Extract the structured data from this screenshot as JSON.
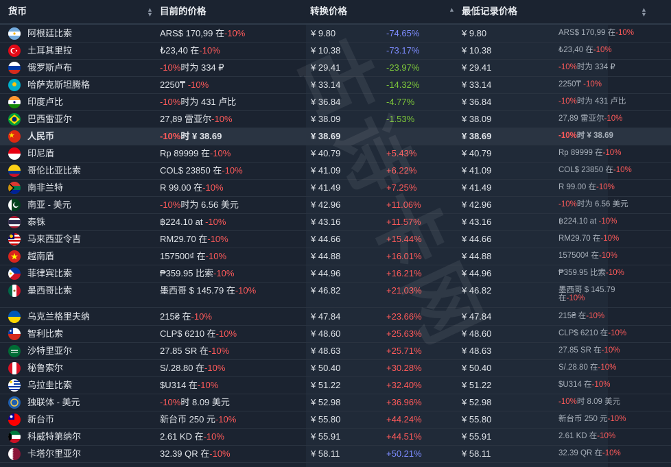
{
  "header": {
    "currency": "货币",
    "current": "目前的价格",
    "converted": "转换价格",
    "lowest": "最低记录价格"
  },
  "watermark": "古诗卡网",
  "colors": {
    "negative_red": "#ff5a5a",
    "pct_blue": "#7d8cff",
    "pct_green": "#7ec83a",
    "pct_red": "#ff5a5a"
  },
  "rows": [
    {
      "name": "阿根廷比索",
      "flag": "flag-ar",
      "cur": "ARS$ 170,99 在",
      "off": "-10%",
      "conv": "¥ 9.80",
      "pct": "-74.65%",
      "pcolor": "blue",
      "low": "¥ 9.80",
      "low_cur": "ARS$ 170,99 在",
      "low_off": "-10%"
    },
    {
      "name": "土耳其里拉",
      "flag": "flag-tr",
      "cur": "₺23,40 在",
      "off": "-10%",
      "conv": "¥ 10.38",
      "pct": "-73.17%",
      "pcolor": "blue",
      "low": "¥ 10.38",
      "low_cur": "₺23,40 在",
      "low_off": "-10%"
    },
    {
      "name": "俄罗斯卢布",
      "flag": "flag-ru",
      "pre": "-10%",
      "cur": "时为 334 ₽",
      "off": "",
      "conv": "¥ 29.41",
      "pct": "-23.97%",
      "pcolor": "green",
      "low": "¥ 29.41",
      "low_pre": "-10%",
      "low_cur": "时为 334 ₽",
      "low_off": ""
    },
    {
      "name": "哈萨克斯坦腾格",
      "flag": "flag-kz",
      "cur": "2250₸ ",
      "off": "-10%",
      "conv": "¥ 33.14",
      "pct": "-14.32%",
      "pcolor": "green",
      "low": "¥ 33.14",
      "low_cur": "2250₸ ",
      "low_off": "-10%"
    },
    {
      "name": "印度卢比",
      "flag": "flag-in",
      "pre": "-10%",
      "cur": "时为 431 卢比",
      "off": "",
      "conv": "¥ 36.84",
      "pct": "-4.77%",
      "pcolor": "green",
      "low": "¥ 36.84",
      "low_pre": "-10%",
      "low_cur": "时为 431 卢比",
      "low_off": ""
    },
    {
      "name": "巴西雷亚尔",
      "flag": "flag-br",
      "cur": "27,89 雷亚尔",
      "off": "-10%",
      "conv": "¥ 38.09",
      "pct": "-1.53%",
      "pcolor": "green",
      "low": "¥ 38.09",
      "low_cur": "27,89 雷亚尔",
      "low_off": "-10%"
    },
    {
      "name": "人民币",
      "flag": "flag-cn",
      "pre": "-10%",
      "cur": "时 ¥ 38.69",
      "off": "",
      "conv": "¥ 38.69",
      "pct": "",
      "pcolor": "",
      "low": "¥ 38.69",
      "low_pre": "-10%",
      "low_cur": "时 ¥ 38.69",
      "low_off": "",
      "highlight": true
    },
    {
      "name": "印尼盾",
      "flag": "flag-id",
      "cur": "Rp 89999 在",
      "off": "-10%",
      "conv": "¥ 40.79",
      "pct": "+5.43%",
      "pcolor": "red",
      "low": "¥ 40.79",
      "low_cur": "Rp 89999 在",
      "low_off": "-10%"
    },
    {
      "name": "哥伦比亚比索",
      "flag": "flag-co",
      "cur": "COL$ 23850 在",
      "off": "-10%",
      "conv": "¥ 41.09",
      "pct": "+6.22%",
      "pcolor": "red",
      "low": "¥ 41.09",
      "low_cur": "COL$ 23850 在",
      "low_off": "-10%"
    },
    {
      "name": "南非兰特",
      "flag": "flag-za",
      "cur": "R 99.00 在",
      "off": "-10%",
      "conv": "¥ 41.49",
      "pct": "+7.25%",
      "pcolor": "red",
      "low": "¥ 41.49",
      "low_cur": "R 99.00 在",
      "low_off": "-10%"
    },
    {
      "name": "南亚 - 美元",
      "flag": "flag-pk",
      "pre": "-10%",
      "cur": "时为 6.56 美元",
      "off": "",
      "conv": "¥ 42.96",
      "pct": "+11.06%",
      "pcolor": "red",
      "low": "¥ 42.96",
      "low_pre": "-10%",
      "low_cur": "时为 6.56 美元",
      "low_off": ""
    },
    {
      "name": "泰铢",
      "flag": "flag-th",
      "cur": "฿224.10 at ",
      "off": "-10%",
      "conv": "¥ 43.16",
      "pct": "+11.57%",
      "pcolor": "red",
      "low": "¥ 43.16",
      "low_cur": "฿224.10 at ",
      "low_off": "-10%"
    },
    {
      "name": "马来西亚令吉",
      "flag": "flag-my",
      "cur": "RM29.70 在",
      "off": "-10%",
      "conv": "¥ 44.66",
      "pct": "+15.44%",
      "pcolor": "red",
      "low": "¥ 44.66",
      "low_cur": "RM29.70 在",
      "low_off": "-10%"
    },
    {
      "name": "越南盾",
      "flag": "flag-vn",
      "cur": "157500₫ 在",
      "off": "-10%",
      "conv": "¥ 44.88",
      "pct": "+16.01%",
      "pcolor": "red",
      "low": "¥ 44.88",
      "low_cur": "157500₫ 在",
      "low_off": "-10%"
    },
    {
      "name": "菲律宾比索",
      "flag": "flag-ph",
      "cur": "₱359.95 比索",
      "off": "-10%",
      "conv": "¥ 44.96",
      "pct": "+16.21%",
      "pcolor": "red",
      "low": "¥ 44.96",
      "low_cur": "₱359.95 比索",
      "low_off": "-10%"
    },
    {
      "name": "墨西哥比索",
      "flag": "flag-mx",
      "cur": "墨西哥 $ 145.79 在",
      "off": "-10%",
      "conv": "¥ 46.82",
      "pct": "+21.03%",
      "pcolor": "red",
      "low": "¥ 46.82",
      "low_cur": "墨西哥 $ 145.79",
      "low_cur2": "在",
      "low_off": "-10%",
      "tall": true
    },
    {
      "name": "乌克兰格里夫纳",
      "flag": "flag-ua",
      "cur": "215₴ 在",
      "off": "-10%",
      "conv": "¥ 47.84",
      "pct": "+23.66%",
      "pcolor": "red",
      "low": "¥ 47.84",
      "low_cur": "215₴ 在",
      "low_off": "-10%"
    },
    {
      "name": "智利比索",
      "flag": "flag-cl",
      "cur": "CLP$ 6210 在",
      "off": "-10%",
      "conv": "¥ 48.60",
      "pct": "+25.63%",
      "pcolor": "red",
      "low": "¥ 48.60",
      "low_cur": "CLP$ 6210 在",
      "low_off": "-10%"
    },
    {
      "name": "沙特里亚尔",
      "flag": "flag-sa",
      "cur": "27.85 SR 在",
      "off": "-10%",
      "conv": "¥ 48.63",
      "pct": "+25.71%",
      "pcolor": "red",
      "low": "¥ 48.63",
      "low_cur": "27.85 SR 在",
      "low_off": "-10%"
    },
    {
      "name": "秘鲁索尔",
      "flag": "flag-pe",
      "cur": "S/.28.80 在",
      "off": "-10%",
      "conv": "¥ 50.40",
      "pct": "+30.28%",
      "pcolor": "red",
      "low": "¥ 50.40",
      "low_cur": "S/.28.80 在",
      "low_off": "-10%"
    },
    {
      "name": "乌拉圭比索",
      "flag": "flag-uy",
      "cur": "$U314 在",
      "off": "-10%",
      "conv": "¥ 51.22",
      "pct": "+32.40%",
      "pcolor": "red",
      "low": "¥ 51.22",
      "low_cur": "$U314 在",
      "low_off": "-10%"
    },
    {
      "name": "独联体 - 美元",
      "flag": "flag-cis",
      "pre": "-10%",
      "cur": "时 8.09 美元",
      "off": "",
      "conv": "¥ 52.98",
      "pct": "+36.96%",
      "pcolor": "red",
      "low": "¥ 52.98",
      "low_pre": "-10%",
      "low_cur": "时 8.09 美元",
      "low_off": ""
    },
    {
      "name": "新台币",
      "flag": "flag-tw",
      "cur": "新台币 250 元",
      "off": "-10%",
      "conv": "¥ 55.80",
      "pct": "+44.24%",
      "pcolor": "red",
      "low": "¥ 55.80",
      "low_cur": "新台币 250 元",
      "low_off": "-10%"
    },
    {
      "name": "科威特第纳尔",
      "flag": "flag-kw",
      "cur": "2.61 KD 在",
      "off": "-10%",
      "conv": "¥ 55.91",
      "pct": "+44.51%",
      "pcolor": "red",
      "low": "¥ 55.91",
      "low_cur": "2.61 KD 在",
      "low_off": "-10%"
    },
    {
      "name": "卡塔尔里亚尔",
      "flag": "flag-qa",
      "cur": "32.39 QR 在",
      "off": "-10%",
      "conv": "¥ 58.11",
      "pct": "+50.21%",
      "pcolor": "blue",
      "low": "¥ 58.11",
      "low_cur": "32.39 QR 在",
      "low_off": "-10%"
    }
  ]
}
